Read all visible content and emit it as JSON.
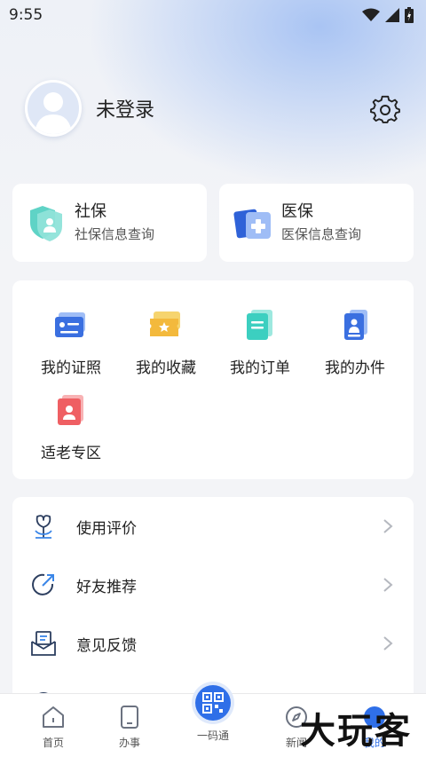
{
  "status_bar": {
    "time": "9:55"
  },
  "profile": {
    "name": "未登录"
  },
  "services": [
    {
      "title": "社保",
      "subtitle": "社保信息查询"
    },
    {
      "title": "医保",
      "subtitle": "医保信息查询"
    }
  ],
  "grid": [
    {
      "label": "我的证照",
      "icon": "id-card-icon"
    },
    {
      "label": "我的收藏",
      "icon": "favorites-ticket-icon"
    },
    {
      "label": "我的订单",
      "icon": "order-document-icon"
    },
    {
      "label": "我的办件",
      "icon": "case-file-icon"
    },
    {
      "label": "适老专区",
      "icon": "elderly-zone-icon"
    }
  ],
  "list": [
    {
      "label": "使用评价",
      "icon": "flower-review-icon"
    },
    {
      "label": "好友推荐",
      "icon": "share-arrow-icon"
    },
    {
      "label": "意见反馈",
      "icon": "feedback-mail-icon"
    }
  ],
  "tabs": [
    {
      "label": "首页",
      "icon": "home-icon"
    },
    {
      "label": "办事",
      "icon": "tablet-icon"
    },
    {
      "label": "一码通",
      "icon": "qr-code-icon"
    },
    {
      "label": "新闻",
      "icon": "compass-icon"
    },
    {
      "label": "我的",
      "icon": "profile-dot-icon"
    }
  ],
  "watermark": "大玩客",
  "colors": {
    "accent": "#2f6fe8",
    "background": "#f3f4f7"
  }
}
